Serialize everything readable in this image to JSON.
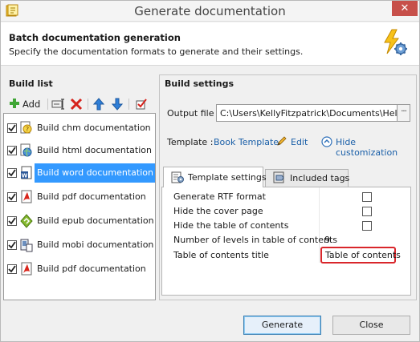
{
  "window": {
    "title": "Generate documentation",
    "close_glyph": "✕"
  },
  "header": {
    "title": "Batch documentation generation",
    "subtitle": "Specify the documentation formats to generate and their settings.",
    "icon": "wizard-bolt-gear-icon"
  },
  "build_list": {
    "label": "Build list",
    "add_label": "Add",
    "items": [
      {
        "label": "Build chm documentation",
        "checked": true,
        "icon": "chm-icon",
        "selected": false
      },
      {
        "label": "Build html documentation",
        "checked": true,
        "icon": "html-globe-icon",
        "selected": false
      },
      {
        "label": "Build word documentation",
        "checked": true,
        "icon": "word-icon",
        "selected": true
      },
      {
        "label": "Build pdf documentation",
        "checked": true,
        "icon": "pdf-icon",
        "selected": false
      },
      {
        "label": "Build epub documentation",
        "checked": true,
        "icon": "epub-icon",
        "selected": false
      },
      {
        "label": "Build mobi documentation",
        "checked": true,
        "icon": "mobi-icon",
        "selected": false
      },
      {
        "label": "Build pdf documentation",
        "checked": true,
        "icon": "pdf-icon",
        "selected": false
      }
    ]
  },
  "build_settings": {
    "label": "Build settings",
    "output_label": "Output file :",
    "output_value": "C:\\Users\\KellyFitzpatrick\\Documents\\HelpNDoc",
    "browse_label": "···",
    "template_label": "Template :",
    "template_name": "Book Template",
    "edit_label": "Edit",
    "hide_label": "Hide customization"
  },
  "tabs": [
    {
      "label": "Template settings",
      "active": true
    },
    {
      "label": "Included tags",
      "active": false
    }
  ],
  "properties": [
    {
      "name": "Generate RTF format",
      "type": "checkbox",
      "checked": false
    },
    {
      "name": "Hide the cover page",
      "type": "checkbox",
      "checked": false
    },
    {
      "name": "Hide the table of contents",
      "type": "checkbox",
      "checked": false
    },
    {
      "name": "Number of levels in table of contents",
      "type": "value",
      "value": "9"
    },
    {
      "name": "Table of contents title",
      "type": "value",
      "value": "Table of contents",
      "highlighted": true
    }
  ],
  "buttons": {
    "generate": "Generate",
    "close": "Close"
  },
  "colors": {
    "selection": "#3399ff",
    "link": "#1a5fa8",
    "highlight_border": "#d9262b",
    "close_button": "#c7504a"
  }
}
